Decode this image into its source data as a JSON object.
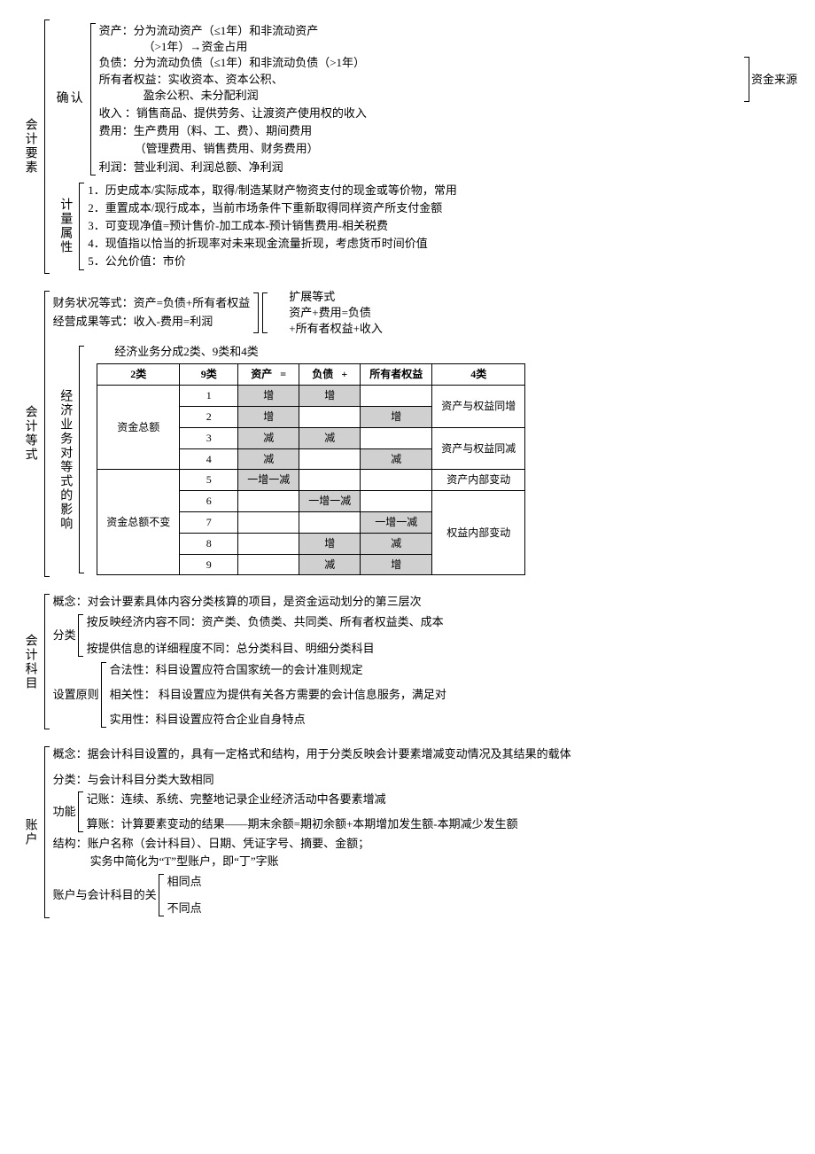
{
  "s1": {
    "label": "会计要素",
    "confirm": {
      "label": "确认",
      "l1": "资产：分为流动资产（≤1年）和非流动资产",
      "l1b": "（>1年）→资金占用",
      "l2": "负债：分为流动负债（≤1年）和非流动负债（>1年）",
      "l3": "所有者权益：实收资本、资本公积、",
      "l3b": "盈余公积、未分配利润",
      "src": "资金来源",
      "l4": "收入 ：销售商品、提供劳务、让渡资产使用权的收入",
      "l5": "费用：生产费用（料、工、费）、期间费用",
      "l5b": "（管理费用、销售费用、财务费用）",
      "l6": "利润：营业利润、利润总额、净利润"
    },
    "measure": {
      "label": "计量属性",
      "l1": "1．历史成本/实际成本，取得/制造某财产物资支付的现金或等价物，常用",
      "l2": "2．重置成本/现行成本，当前市场条件下重新取得同样资产所支付金额",
      "l3": "3．可变现净值=预计售价-加工成本-预计销售费用-相关税费",
      "l4": "4．现值指以恰当的折现率对未来现金流量折现，考虑货币时间价值",
      "l5": "5．公允价值：市价"
    }
  },
  "s2": {
    "label": "会计等式",
    "eq1": "财务状况等式：资产=负债+所有者权益",
    "eq2": "经营成果等式：收入-费用=利润",
    "ext_label": "扩展等式",
    "ext1": "资产+费用=负债",
    "ext2": "+所有者权益+收入",
    "impact_label": "经济业务对等式的影响",
    "tbl_title": "经济业务分成2类、9类和4类",
    "tbl": {
      "h": [
        "2类",
        "9类",
        "资产",
        "=",
        "负债",
        "+",
        "所有者权益",
        "4类"
      ],
      "r1": [
        "1",
        "增",
        "",
        "增",
        "",
        "",
        "资产与权益同增"
      ],
      "r2": [
        "2",
        "增",
        "",
        "",
        "",
        "增"
      ],
      "r3": [
        "3",
        "减",
        "",
        "减",
        "",
        "",
        "资产与权益同减"
      ],
      "r4": [
        "4",
        "减",
        "",
        "",
        "",
        "减"
      ],
      "r5": [
        "5",
        "一增一减",
        "",
        "",
        "",
        "",
        "资产内部变动"
      ],
      "r6": [
        "6",
        "",
        "",
        "一增一减",
        "",
        "",
        "权益内部变动"
      ],
      "r7": [
        "7",
        "",
        "",
        "",
        "",
        "一增一减"
      ],
      "r8": [
        "8",
        "",
        "",
        "增",
        "",
        "减"
      ],
      "r9": [
        "9",
        "",
        "",
        "减",
        "",
        "增"
      ],
      "g1": "资金总额",
      "g2": "资金总额不变"
    }
  },
  "s3": {
    "label": "会计科目",
    "concept": "概念：对会计要素具体内容分类核算的项目，是资金运动划分的第三层次",
    "class_label": "分类",
    "c1": "按反映经济内容不同：资产类、负债类、共同类、所有者权益类、成本",
    "c2": "按提供信息的详细程度不同：总分类科目、明细分类科目",
    "prin_label": "设置原则",
    "p1": "合法性：科目设置应符合国家统一的会计准则规定",
    "p2": "相关性： 科目设置应为提供有关各方需要的会计信息服务，满足对",
    "p3": "实用性：科目设置应符合企业自身特点"
  },
  "s4": {
    "label": "账户",
    "concept": "概念：据会计科目设置的，具有一定格式和结构，用于分类反映会计要素增减变动情况及其结果的载体",
    "class": "分类：与会计科目分类大致相同",
    "func_label": "功能",
    "f1": "记账：连续、系统、完整地记录企业经济活动中各要素增减",
    "f2": "算账：计算要素变动的结果——期末余额=期初余额+本期增加发生额-本期减少发生额",
    "struct": "结构：账户名称（会计科目）、日期、凭证字号、摘要、金额；",
    "struct2": "实务中简化为“T”型账户，即“丁”字账",
    "rel_label": "账户与会计科目的关",
    "r1": "相同点",
    "r2": "不同点"
  }
}
